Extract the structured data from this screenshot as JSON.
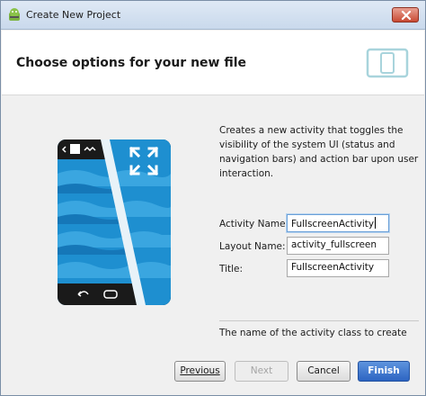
{
  "window": {
    "title": "Create New Project"
  },
  "header": {
    "title": "Choose options for your new file"
  },
  "description": "Creates a new activity that toggles the visibility of the system UI (status and navigation bars) and action bar upon user interaction.",
  "form": {
    "activity_name_label": "Activity Name:",
    "activity_name_value": "FullscreenActivity",
    "layout_name_label": "Layout Name:",
    "layout_name_value": "activity_fullscreen",
    "title_label": "Title:",
    "title_value": "FullscreenActivity"
  },
  "hint": "The name of the activity class to create",
  "buttons": {
    "previous": "Previous",
    "next": "Next",
    "cancel": "Cancel",
    "finish": "Finish"
  },
  "colors": {
    "accent": "#2d64c2",
    "illustration_blue": "#1e8fd0",
    "header_icon": "#a8d4dc"
  }
}
